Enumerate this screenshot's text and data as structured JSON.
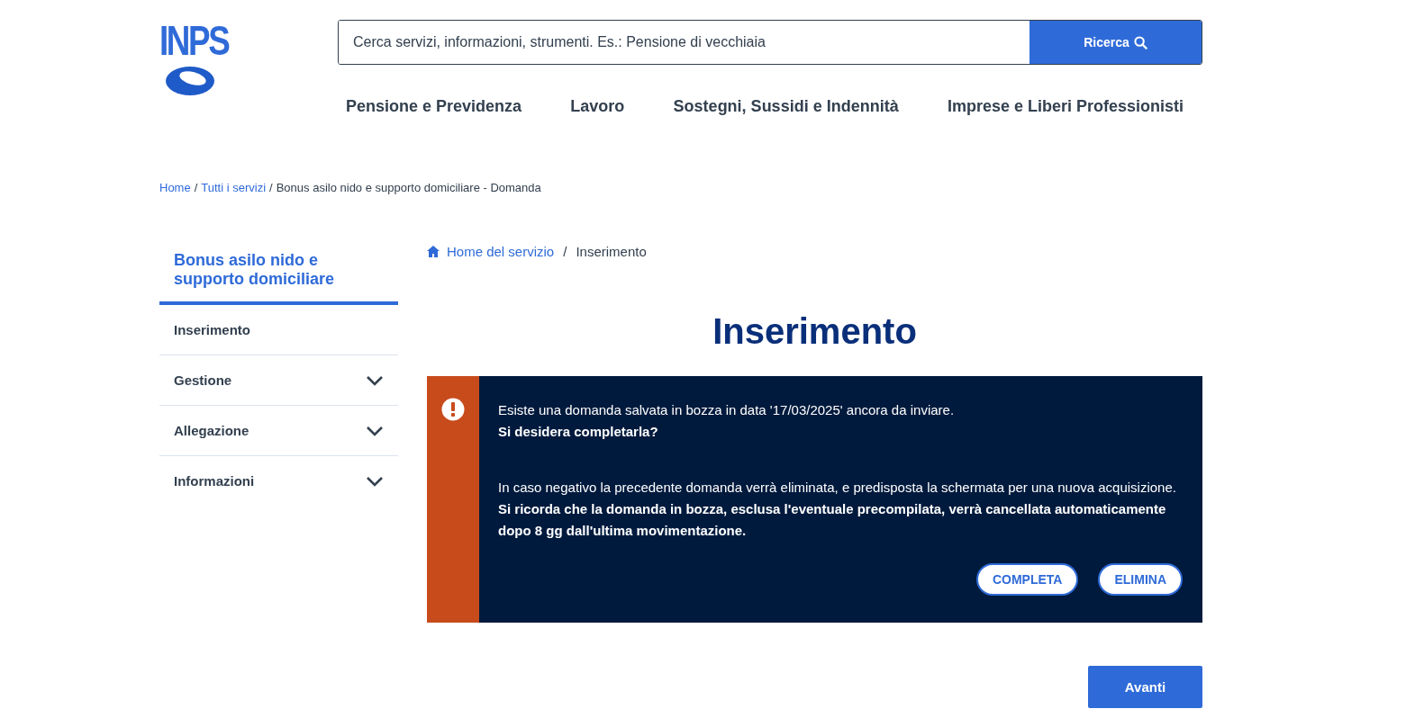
{
  "header": {
    "logo_text": "INPS",
    "search": {
      "placeholder": "Cerca servizi, informazioni, strumenti. Es.: Pensione di vecchiaia",
      "button": "Ricerca"
    },
    "nav": [
      "Pensione e Previdenza",
      "Lavoro",
      "Sostegni, Sussidi e Indennità",
      "Imprese e Liberi Professionisti"
    ]
  },
  "breadcrumb_separator": "/",
  "breadcrumb": [
    {
      "label": "Home",
      "kind": "link"
    },
    {
      "label": "Tutti i servizi",
      "kind": "link"
    },
    {
      "label": "Bonus asilo nido e supporto domiciliare - Domanda",
      "kind": "current"
    }
  ],
  "sidebar": {
    "title": "Bonus asilo nido e supporto domiciliare",
    "items": [
      {
        "label": "Inserimento",
        "kind": "link"
      },
      {
        "label": "Gestione",
        "kind": "group",
        "expanded": false
      },
      {
        "label": "Allegazione",
        "kind": "group",
        "expanded": false
      },
      {
        "label": "Informazioni",
        "kind": "group",
        "expanded": false
      }
    ]
  },
  "service_breadcrumb_separator": "/",
  "service_breadcrumb": [
    {
      "label": "Home del servizio",
      "kind": "home"
    },
    {
      "label": "Inserimento",
      "kind": "current"
    }
  ],
  "page_title": "Inserimento",
  "alert": {
    "paragraphs": [
      [
        {
          "text": "Esiste una domanda salvata in bozza in data '17/03/2025' ancora da inviare.",
          "bold": false
        },
        {
          "text": "Si desidera completarla?",
          "bold": true
        }
      ],
      [
        {
          "text": "In caso negativo la precedente domanda verrà eliminata, e predisposta la schermata per una nuova acquisizione.",
          "bold": false
        },
        {
          "text": "Si ricorda che la domanda in bozza, esclusa l'eventuale precompilata, verrà cancellata automaticamente dopo 8 gg dall'ultima movimentazione.",
          "bold": true
        }
      ]
    ],
    "buttons": [
      "COMPLETA",
      "ELIMINA"
    ]
  },
  "next_button": "Avanti"
}
